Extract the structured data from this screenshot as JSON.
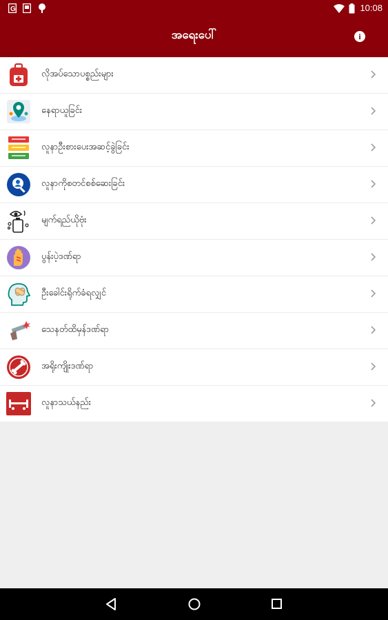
{
  "status_bar": {
    "time": "10:08",
    "icons": [
      "notification-icon",
      "sim-card-icon",
      "tree-icon",
      "wifi-icon",
      "battery-icon"
    ]
  },
  "app_bar": {
    "title": "အရေးပေါ်",
    "info_icon": "info-icon",
    "color": "#8b0009"
  },
  "list": {
    "items": [
      {
        "label": "လိုအပ်သောပစ္စည်းများ",
        "icon": "first-aid-bag-icon"
      },
      {
        "label": "နေရာယူခြင်း",
        "icon": "location-pin-icon"
      },
      {
        "label": "လူနာဦးစားပေးအဆင့်ခွဲခြင်း",
        "icon": "triage-color-bars-icon"
      },
      {
        "label": "လူနာကိုစတင်စစ်ဆေးခြင်း",
        "icon": "person-search-icon"
      },
      {
        "label": "မျက်ရည်ယိုဗုံး",
        "icon": "tear-gas-icon"
      },
      {
        "label": "ပွန်းပဲ့ဒဏ်ရာ",
        "icon": "hand-abrasion-icon"
      },
      {
        "label": "ဦးခေါင်းရိုက်ခံရလျှင်",
        "icon": "head-injury-icon"
      },
      {
        "label": "သေနတ်ထိမှန်ဒဏ်ရာ",
        "icon": "gunshot-icon"
      },
      {
        "label": "အရိုးကျိုးဒဏ်ရာ",
        "icon": "broken-bone-icon"
      },
      {
        "label": "လူနာသယ်နည်း",
        "icon": "stretcher-icon"
      }
    ]
  },
  "nav_bar": {
    "icons": [
      "back-icon",
      "home-icon",
      "recents-icon"
    ]
  }
}
